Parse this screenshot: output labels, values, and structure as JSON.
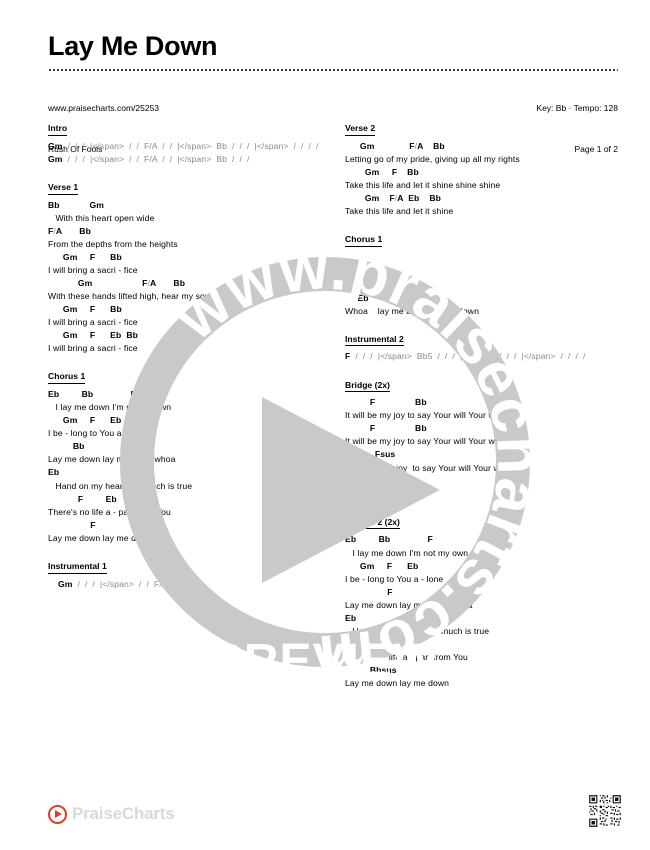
{
  "header": {
    "title": "Lay Me Down",
    "url": "www.praisecharts.com/25253",
    "artist": "Rush Of Fools",
    "key_tempo": "Key: Bb · Tempo: 128",
    "page_indicator": "Page 1 of 2"
  },
  "watermark": {
    "ring_text": "www.praisecharts.com",
    "preview_text": "PREVIEW",
    "play_icon": "play-triangle-icon"
  },
  "footer": {
    "logo_text": "PraiseCharts",
    "play_icon": "play-circle-icon",
    "qr_icon": "qr-code-icon"
  },
  "left_column": [
    {
      "label": "Intro",
      "lines": [
        {
          "type": "chord",
          "text": "Gm  /  /  /  |  /  /  F/A  /  /  |  Bb  /  /  /  |  /  /  /  /"
        },
        {
          "type": "chord",
          "text": "Gm  /  /  /  |  /  /  F/A  /  /  |  Bb  /  /  /"
        }
      ]
    },
    {
      "label": "Verse 1",
      "lines": [
        {
          "type": "chord",
          "text": "Bb            Gm"
        },
        {
          "type": "lyric",
          "text": "   With this heart open wide"
        },
        {
          "type": "chord",
          "text": "F/A       Bb"
        },
        {
          "type": "lyric",
          "text": "From the depths from the heights"
        },
        {
          "type": "chord",
          "text": "      Gm     F      Bb"
        },
        {
          "type": "lyric",
          "text": "I will bring a sacri - fice"
        },
        {
          "type": "chord",
          "text": "            Gm                    F/A       Bb"
        },
        {
          "type": "lyric",
          "text": "With these hands lifted high, hear my song hear my cry"
        },
        {
          "type": "chord",
          "text": "      Gm     F      Bb"
        },
        {
          "type": "lyric",
          "text": "I will bring a sacri - fice"
        },
        {
          "type": "chord",
          "text": "      Gm     F      Eb  Bb"
        },
        {
          "type": "lyric",
          "text": "I will bring a sacri - fice"
        }
      ]
    },
    {
      "label": "Chorus 1",
      "lines": [
        {
          "type": "chord",
          "text": "Eb         Bb               F"
        },
        {
          "type": "lyric",
          "text": "   I lay me down I'm not my own"
        },
        {
          "type": "chord",
          "text": "      Gm     F      Eb"
        },
        {
          "type": "lyric",
          "text": "I be - long to You a - lone"
        },
        {
          "type": "chord",
          "text": "          Bb                 F"
        },
        {
          "type": "lyric",
          "text": "Lay me down lay me down whoa"
        },
        {
          "type": "chord",
          "text": "Eb                           F"
        },
        {
          "type": "lyric",
          "text": "   Hand on my heart this much is true"
        },
        {
          "type": "chord",
          "text": "            F         Eb"
        },
        {
          "type": "lyric",
          "text": "There's no life a - part from You"
        },
        {
          "type": "chord",
          "text": "                 F"
        },
        {
          "type": "lyric",
          "text": "Lay me down lay me down"
        }
      ]
    },
    {
      "label": "Instrumental 1",
      "lines": [
        {
          "type": "chord",
          "text": "    Gm  /  /  /  |  /  /  F/A  /  /"
        }
      ]
    }
  ],
  "right_column": [
    {
      "label": "Verse 2",
      "lines": [
        {
          "type": "chord",
          "text": "      Gm              F/A    Bb"
        },
        {
          "type": "lyric",
          "text": "Letting go of my pride, giving up all my rights"
        },
        {
          "type": "chord",
          "text": "        Gm     F    Bb"
        },
        {
          "type": "lyric",
          "text": "Take this life and let it shine shine shine"
        },
        {
          "type": "chord",
          "text": "        Gm    F/A  Eb    Bb"
        },
        {
          "type": "lyric",
          "text": "Take this life and let it shine"
        }
      ]
    },
    {
      "label": "Chorus 1",
      "lines": []
    },
    {
      "label": "Tag 1",
      "lines": [
        {
          "type": "chord",
          "text": "     Eb        Bb/D       F"
        },
        {
          "type": "lyric",
          "text": "Whoa    lay me down lay me down"
        }
      ]
    },
    {
      "label": "Instrumental 2",
      "lines": [
        {
          "type": "chord",
          "text": "F  /  /  /  |  Bb5  /  /  /  |  /  /  /  |  /  /  /  /"
        }
      ]
    },
    {
      "label": "Bridge (2x)",
      "lines": [
        {
          "type": "chord",
          "text": "          F                Bb"
        },
        {
          "type": "lyric",
          "text": "It will be my joy to say Your will Your way"
        },
        {
          "type": "chord",
          "text": "          F                Bb"
        },
        {
          "type": "lyric",
          "text": "It will be my joy to say Your will Your way"
        },
        {
          "type": "chord",
          "text": "            Fsus"
        },
        {
          "type": "lyric",
          "text": "It will be my  joy  to say Your will Your way"
        },
        {
          "type": "chord",
          "text": "Bbsus  Bb     (F)"
        },
        {
          "type": "lyric",
          "text": "  Al   - ways"
        }
      ]
    },
    {
      "label": "Chorus 2 (2x)",
      "lines": [
        {
          "type": "chord",
          "text": "Eb         Bb               F"
        },
        {
          "type": "lyric",
          "text": "   I lay me down I'm not my own"
        },
        {
          "type": "chord",
          "text": "      Gm     F      Eb"
        },
        {
          "type": "lyric",
          "text": "I be - long to You a - lone"
        },
        {
          "type": "chord",
          "text": "                 F"
        },
        {
          "type": "lyric",
          "text": "Lay me down lay me down whoa"
        },
        {
          "type": "chord",
          "text": "Eb                           F"
        },
        {
          "type": "lyric",
          "text": "   Hand on my heart this much is true"
        },
        {
          "type": "chord",
          "text": "            F         Eb"
        },
        {
          "type": "lyric",
          "text": "There's no life a - part from You"
        },
        {
          "type": "chord",
          "text": "          Bbsus"
        },
        {
          "type": "lyric",
          "text": "Lay me down lay me down"
        }
      ]
    }
  ]
}
